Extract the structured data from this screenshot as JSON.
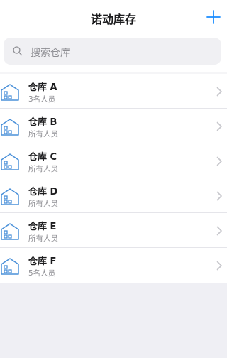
{
  "header": {
    "title": "诺动库存",
    "add_icon": "plus-icon"
  },
  "search": {
    "placeholder": "搜索仓库",
    "icon": "search-icon"
  },
  "warehouses": [
    {
      "name": "仓库 A",
      "members": "3名人员"
    },
    {
      "name": "仓库 B",
      "members": "所有人员"
    },
    {
      "name": "仓库 C",
      "members": "所有人员"
    },
    {
      "name": "仓库 D",
      "members": "所有人员"
    },
    {
      "name": "仓库 E",
      "members": "所有人员"
    },
    {
      "name": "仓库 F",
      "members": "5名人员"
    }
  ],
  "colors": {
    "accent": "#1a8cff",
    "icon_blue": "#4a90d9"
  }
}
